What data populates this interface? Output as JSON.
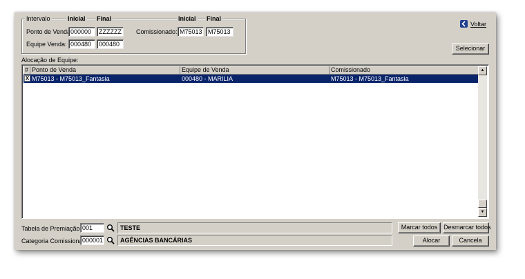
{
  "interval": {
    "title": "Intervalo",
    "col_initial": "Inicial",
    "col_final": "Final",
    "ponto_venda_label": "Ponto de Venda:",
    "ponto_venda_initial": "000000",
    "ponto_venda_final": "ZZZZZZ",
    "equipe_venda_label": "Equipe Venda:",
    "equipe_venda_initial": "000480",
    "equipe_venda_final": "000480",
    "comissionado_col_initial": "Inicial",
    "comissionado_col_final": "Final",
    "comissionado_label": "Comissionado:",
    "comissionado_initial": "M75013",
    "comissionado_final": "M75013"
  },
  "actions": {
    "voltar_label": "Voltar",
    "selecionar_label": "Selecionar"
  },
  "grid": {
    "title": "Alocação de Equipe:",
    "columns": [
      "#",
      "Ponto de Venda",
      "Equipe de Venda",
      "Comissionado"
    ],
    "rows": [
      {
        "checked": "X",
        "ponto_venda": "M75013 - M75013_Fantasia",
        "equipe_venda": "000480 - MARILIA",
        "comissionado": "M75013 - M75013_Fantasia"
      }
    ]
  },
  "footer": {
    "tabela_label": "Tabela de Premiação:",
    "tabela_code": "001",
    "tabela_desc": "TESTE",
    "categoria_label": "Categoria Comissionado:",
    "categoria_code": "000001",
    "categoria_desc": "AGÊNCIAS BANCÁRIAS",
    "marcar_todos": "Marcar todos",
    "desmarcar_todos": "Desmarcar todos",
    "alocar": "Alocar",
    "cancela": "Cancela"
  },
  "colors": {
    "selection": "#0a246a",
    "face": "#d4d0c8",
    "voltar_icon": "#1f3f8f"
  },
  "icons": [
    "voltar-arrow-icon",
    "search-icon",
    "scroll-up-icon",
    "scroll-down-icon",
    "checkbox-checked-icon"
  ]
}
